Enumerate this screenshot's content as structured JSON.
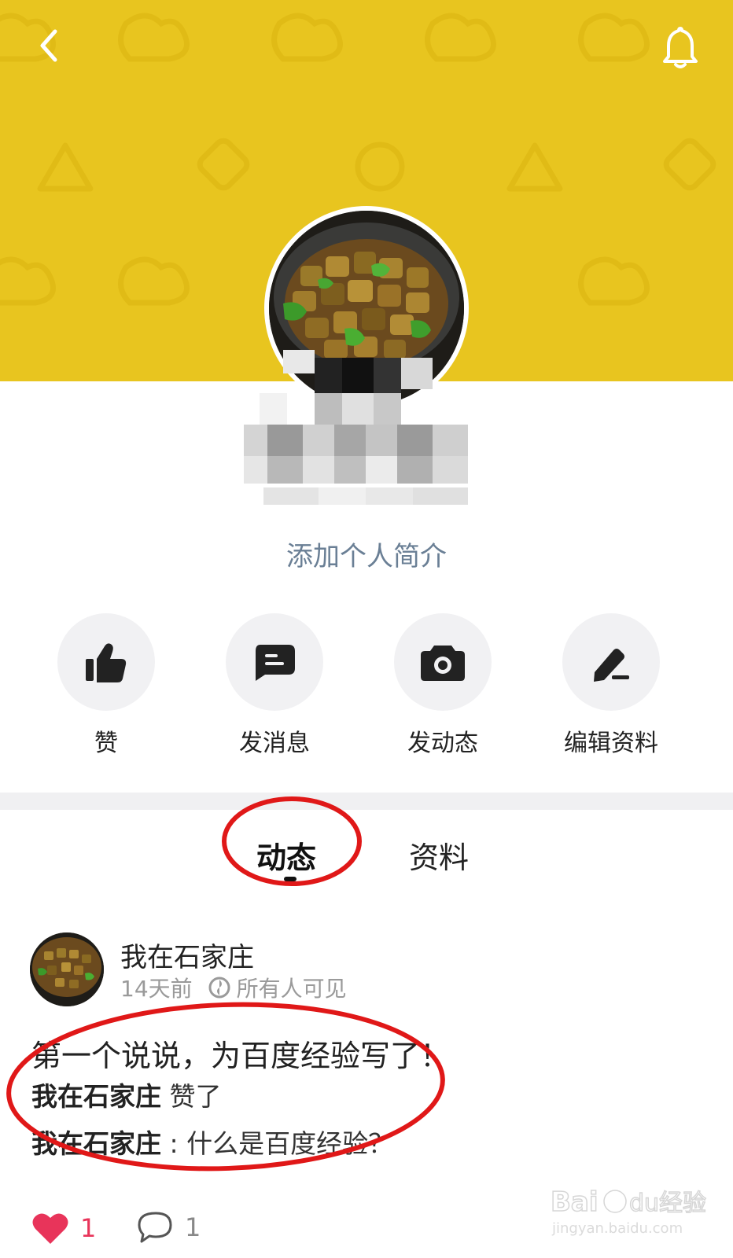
{
  "header": {
    "back_icon": "chevron-left-icon",
    "bell_icon": "bell-icon",
    "banner_color": "#e8c51f"
  },
  "profile": {
    "bio_placeholder": "添加个人简介"
  },
  "actions": [
    {
      "label": "赞",
      "icon": "thumbs-up-icon"
    },
    {
      "label": "发消息",
      "icon": "message-icon"
    },
    {
      "label": "发动态",
      "icon": "camera-icon"
    },
    {
      "label": "编辑资料",
      "icon": "edit-icon"
    }
  ],
  "tabs": [
    {
      "label": "动态",
      "active": true
    },
    {
      "label": "资料",
      "active": false
    }
  ],
  "post": {
    "username": "我在石家庄",
    "time": "14天前",
    "visibility": "所有人可见",
    "text": "第一个说说，为百度经验写了！",
    "like_activity": {
      "user": "我在石家庄",
      "action": "赞了"
    },
    "comment": {
      "user": "我在石家庄",
      "separator": ":",
      "text": "什么是百度经验？"
    },
    "likes": "1",
    "comments": "1"
  },
  "watermark": {
    "logo": "Bai du 经验",
    "url": "jingyan.baidu.com"
  },
  "colors": {
    "annotation": "#e01818",
    "like": "#e8345a"
  }
}
